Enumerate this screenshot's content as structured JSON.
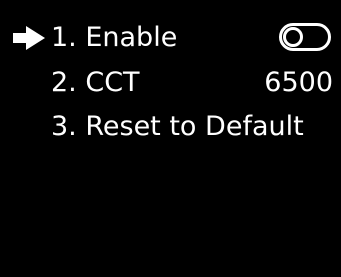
{
  "menu": {
    "items": [
      {
        "label": "1. Enable",
        "control": "toggle",
        "toggle_on": false,
        "selected": true
      },
      {
        "label": "2. CCT",
        "value": "6500",
        "selected": false
      },
      {
        "label": "3. Reset to Default",
        "selected": false
      }
    ]
  },
  "icons": {
    "cursor": "arrow-right-icon",
    "toggle": "toggle-switch-icon"
  },
  "colors": {
    "background": "#000000",
    "foreground": "#ffffff"
  }
}
